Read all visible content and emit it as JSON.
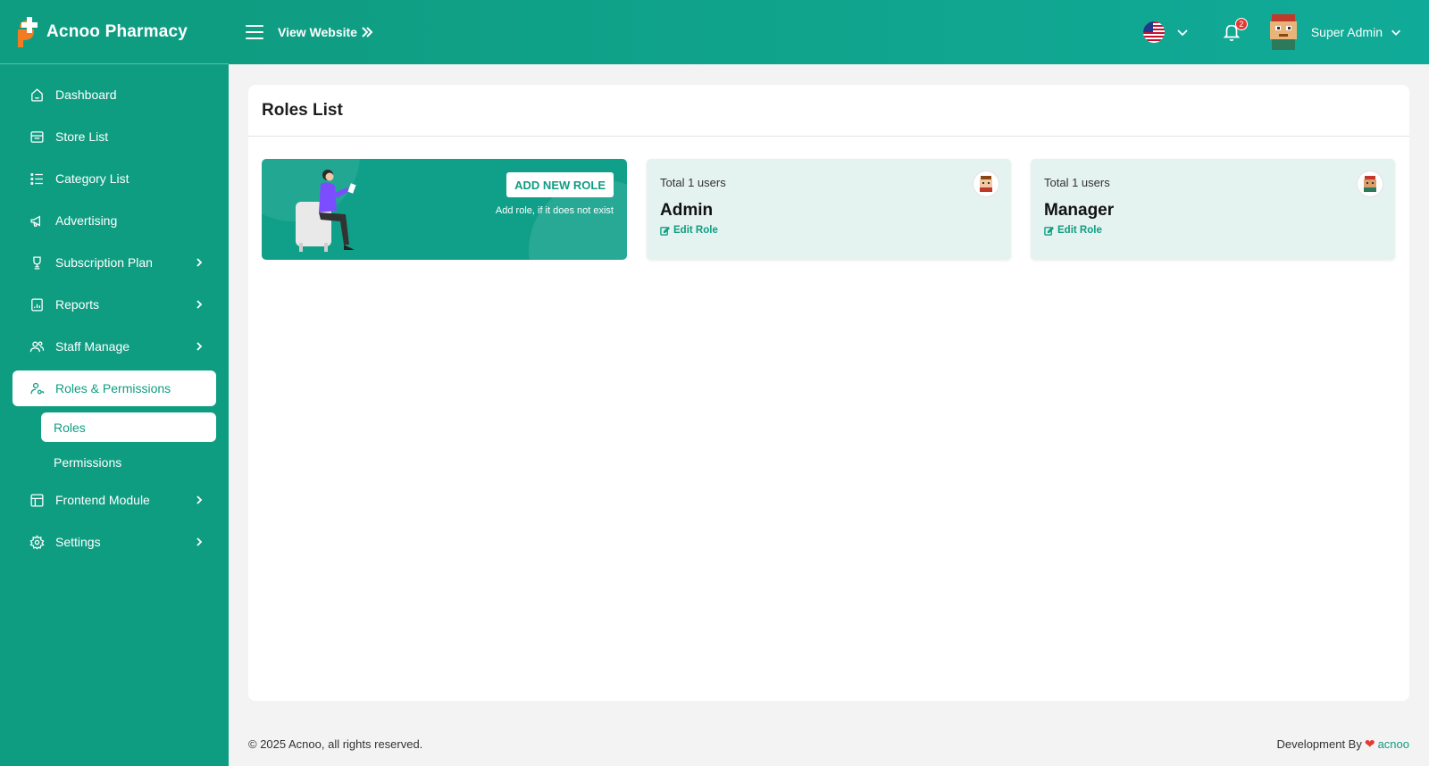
{
  "brand": {
    "name": "Acnoo Pharmacy",
    "logo_icon": "pharmacy-cross-logo"
  },
  "colors": {
    "primary": "#0f9d82",
    "primary_light": "#10ab98",
    "card_tint": "#e4f2f0",
    "badge": "#e53935"
  },
  "sidebar": {
    "items": [
      {
        "label": "Dashboard",
        "icon": "home-icon"
      },
      {
        "label": "Store List",
        "icon": "store-icon"
      },
      {
        "label": "Category List",
        "icon": "list-icon"
      },
      {
        "label": "Advertising",
        "icon": "megaphone-icon"
      },
      {
        "label": "Subscription Plan",
        "icon": "trophy-icon"
      },
      {
        "label": "Reports",
        "icon": "report-icon"
      },
      {
        "label": "Staff Manage",
        "icon": "users-icon"
      },
      {
        "label": "Roles & Permissions",
        "icon": "user-key-icon"
      },
      {
        "label": "Frontend Module",
        "icon": "layout-icon"
      },
      {
        "label": "Settings",
        "icon": "gear-icon"
      }
    ],
    "sub_items": [
      {
        "label": "Roles"
      },
      {
        "label": "Permissions"
      }
    ]
  },
  "topbar": {
    "view_website": "View Website",
    "language_flag": "us-flag-icon",
    "notification_count": "2",
    "user_name": "Super Admin"
  },
  "page": {
    "title": "Roles List",
    "add_role": {
      "button": "ADD NEW ROLE",
      "description": "Add role, if it does not exist"
    },
    "roles": [
      {
        "users": "Total 1 users",
        "name": "Admin",
        "edit": "Edit Role"
      },
      {
        "users": "Total 1 users",
        "name": "Manager",
        "edit": "Edit Role"
      }
    ]
  },
  "footer": {
    "copyright": "© 2025 Acnoo, all rights reserved.",
    "dev_by": "Development By",
    "dev_link": "acnoo"
  }
}
